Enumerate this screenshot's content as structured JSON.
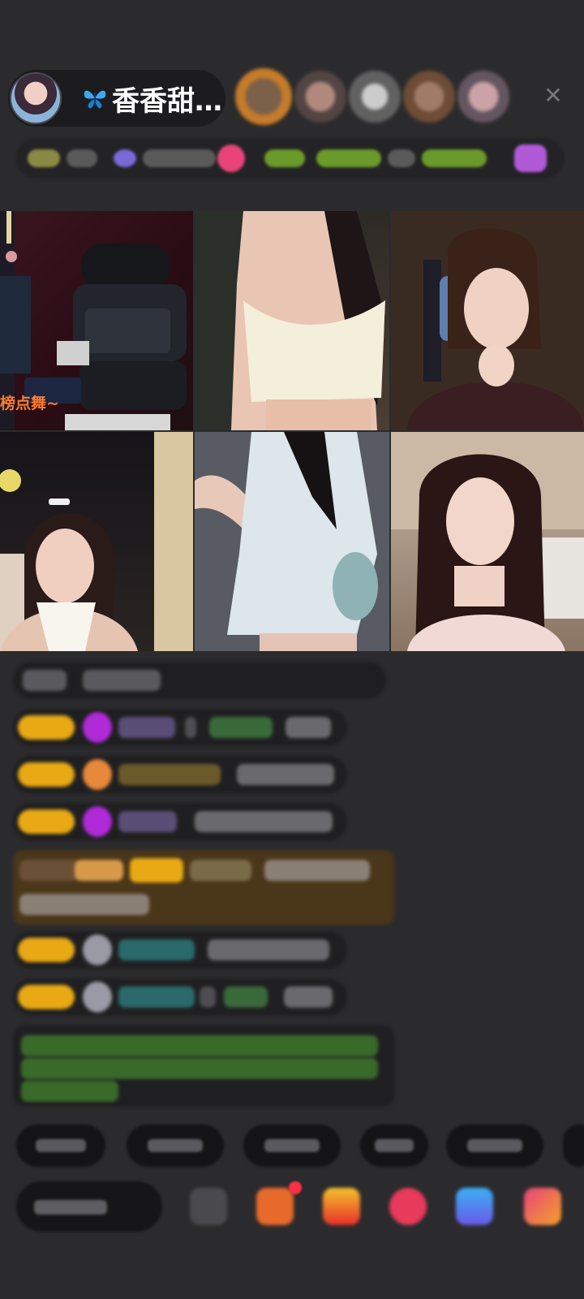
{
  "header": {
    "host_name": "香香甜…",
    "close_glyph": "✕"
  },
  "video_grid": {
    "tile1_caption": "榜点舞~"
  },
  "colors": {
    "background": "#2b2b2d",
    "badge": "#e8a915",
    "caption": "#ff7a2e",
    "gift_row": "#4a3619"
  },
  "icons": [
    "butterfly-icon",
    "close-icon",
    "emoji-icon",
    "gift-icon",
    "present-icon",
    "pk-icon",
    "game-icon",
    "more-icon"
  ]
}
